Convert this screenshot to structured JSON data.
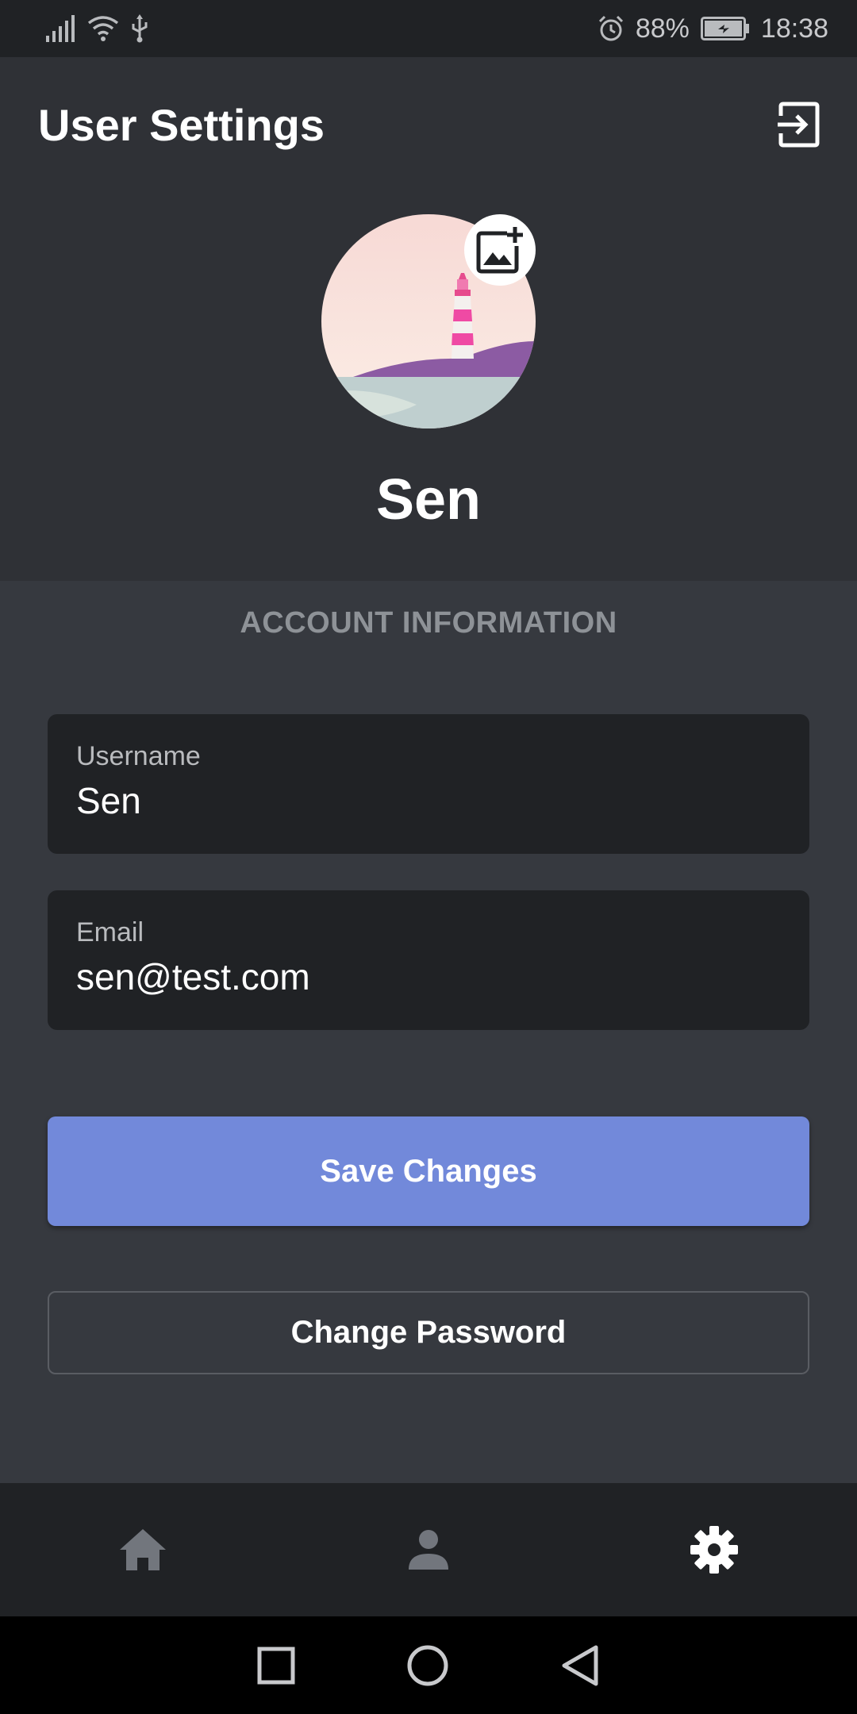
{
  "status_bar": {
    "battery": "88%",
    "time": "18:38"
  },
  "header": {
    "title": "User Settings",
    "display_name": "Sen"
  },
  "account": {
    "section_label": "ACCOUNT INFORMATION",
    "username_label": "Username",
    "username_value": "Sen",
    "email_label": "Email",
    "email_value": "sen@test.com"
  },
  "actions": {
    "save_label": "Save Changes",
    "change_password_label": "Change Password"
  },
  "tabs": [
    {
      "name": "home",
      "icon": "home-icon",
      "active": false
    },
    {
      "name": "profile",
      "icon": "person-icon",
      "active": false
    },
    {
      "name": "settings",
      "icon": "gear-icon",
      "active": true
    }
  ],
  "colors": {
    "accent": "#7289da",
    "background": "#36393f",
    "header": "#2f3136",
    "field": "#202225"
  }
}
